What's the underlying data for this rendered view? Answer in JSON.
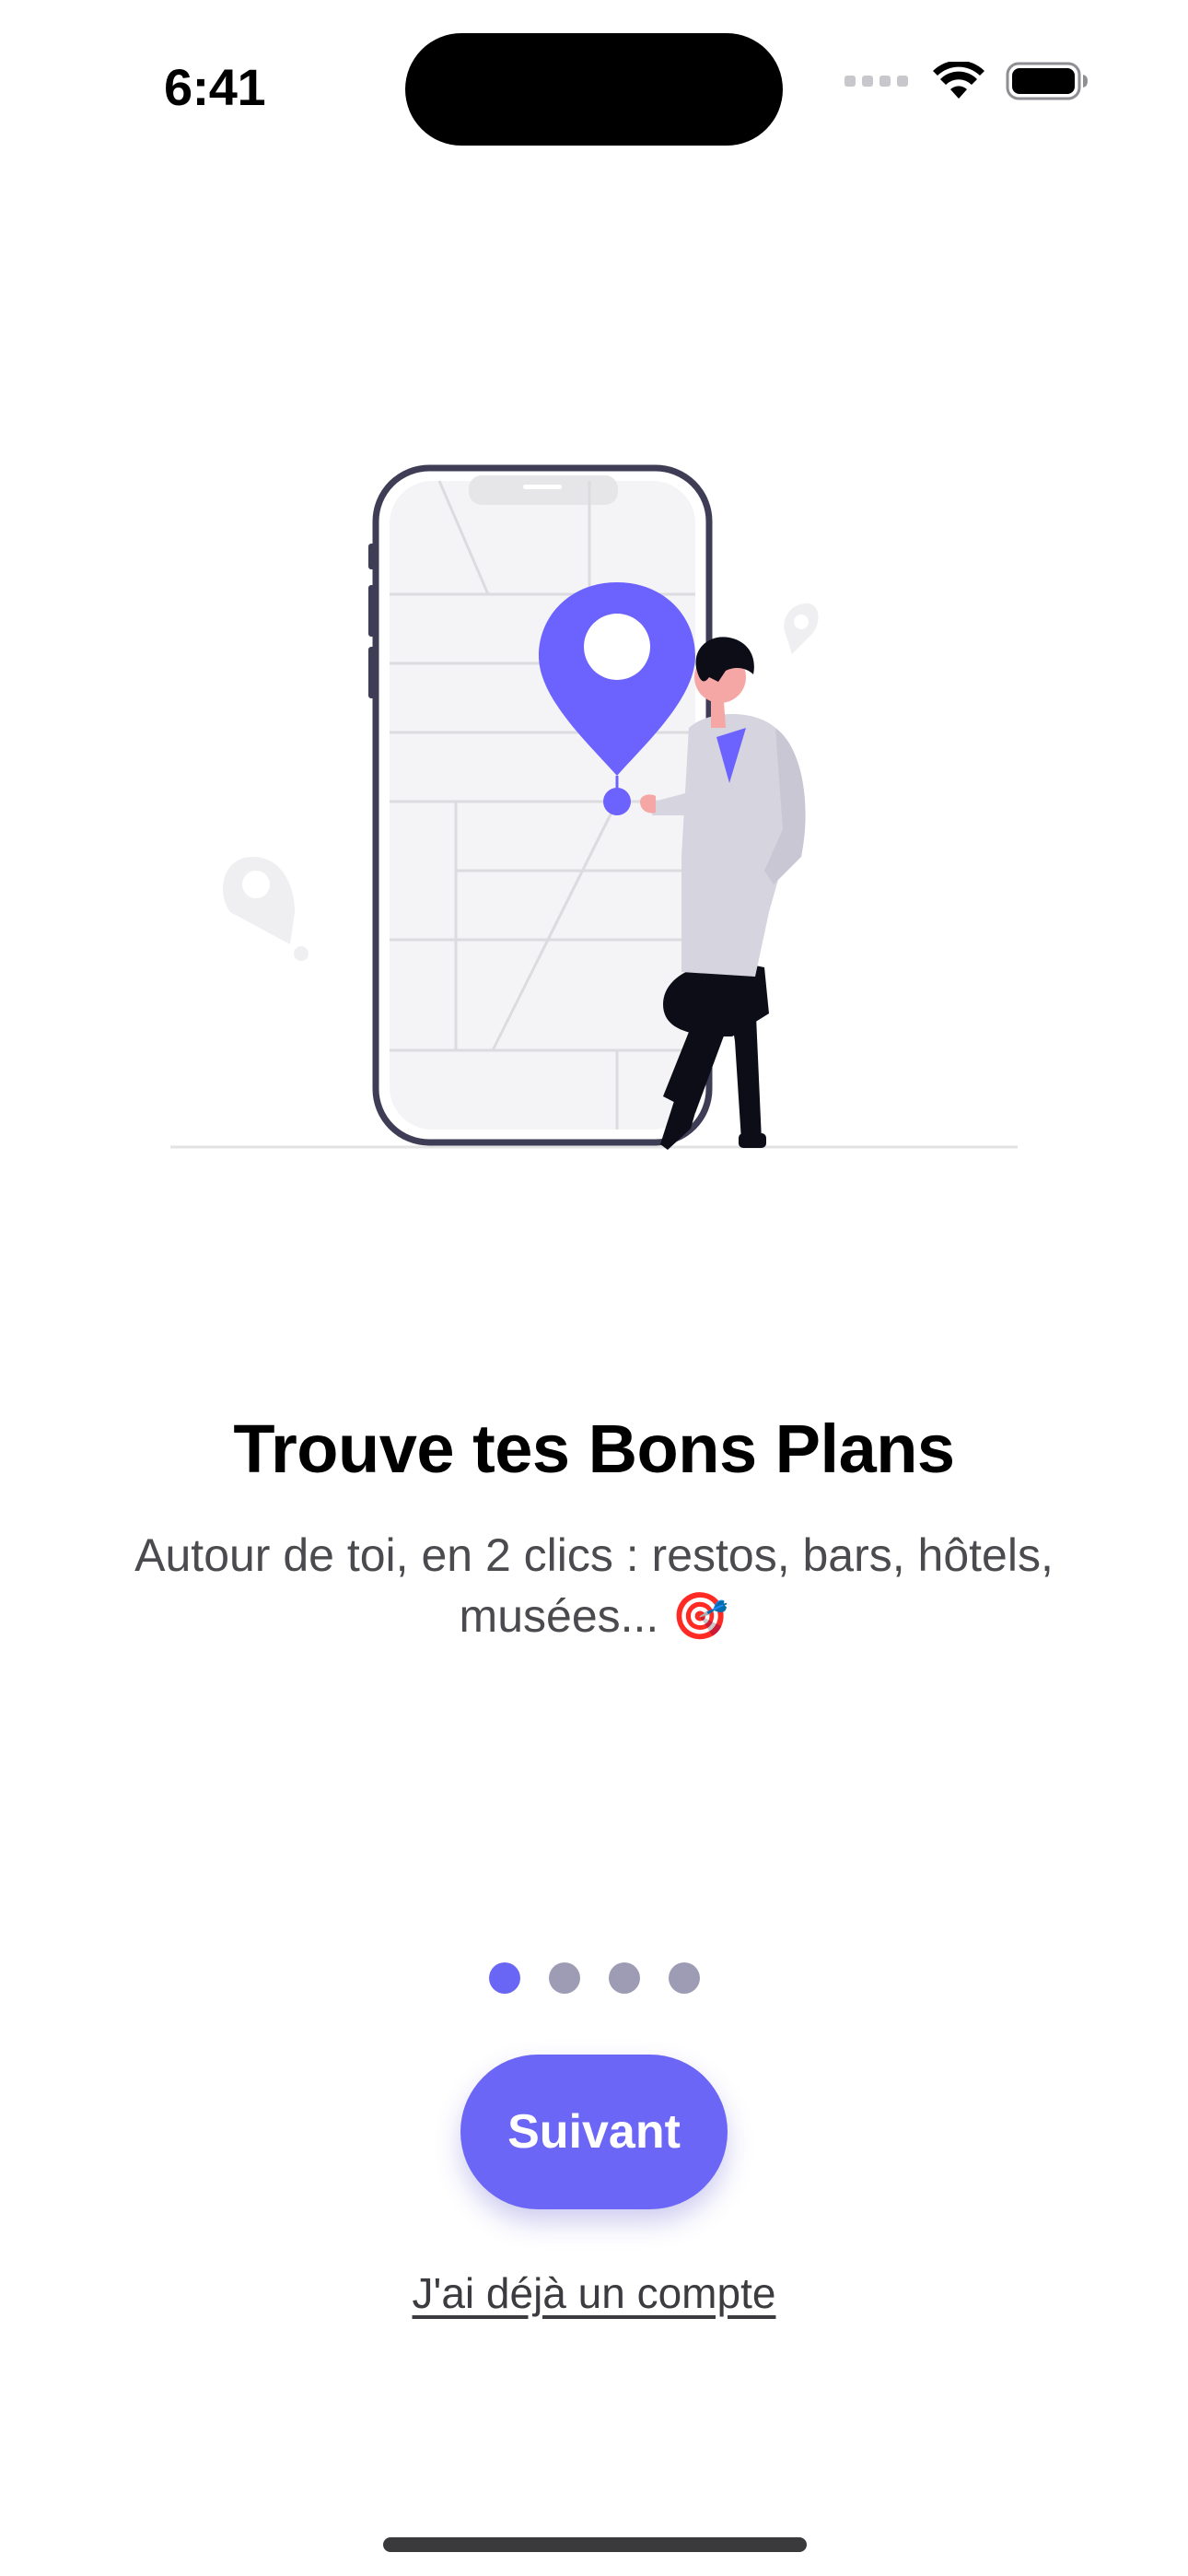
{
  "status_bar": {
    "time": "6:41",
    "icons": [
      "signal-dots-icon",
      "wifi-icon",
      "battery-icon"
    ]
  },
  "illustration": {
    "description_icons": [
      "phone-map-icon",
      "location-pin-icon",
      "person-icon"
    ],
    "accent_color": "#6C63FF"
  },
  "onboarding": {
    "title": "Trouve tes Bons Plans",
    "subtitle": "Autour de toi, en 2 clics : restos, bars, hôtels, musées... 🎯"
  },
  "pagination": {
    "total": 4,
    "active_index": 0
  },
  "actions": {
    "next_label": "Suivant",
    "login_label": "J'ai déjà un compte"
  },
  "colors": {
    "primary": "#6B66F6",
    "dot_inactive": "#9E9CB5",
    "dot_active": "#6966F5"
  }
}
